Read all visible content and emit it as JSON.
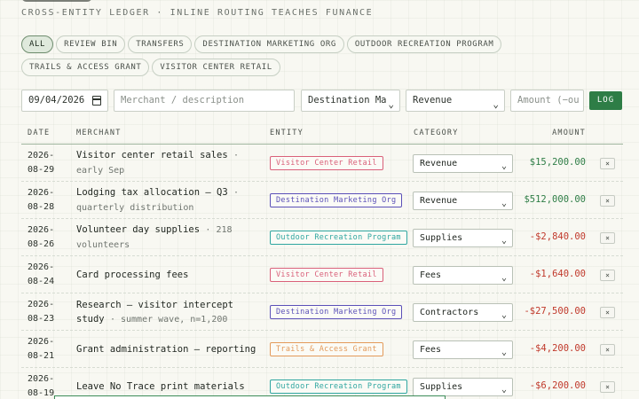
{
  "header": {
    "subtitle": "CROSS-ENTITY LEDGER · INLINE ROUTING TEACHES FUNANCE"
  },
  "filters": [
    {
      "label": "ALL",
      "active": true
    },
    {
      "label": "REVIEW BIN",
      "active": false
    },
    {
      "label": "TRANSFERS",
      "active": false
    },
    {
      "label": "DESTINATION MARKETING ORG",
      "active": false
    },
    {
      "label": "OUTDOOR RECREATION PROGRAM",
      "active": false
    },
    {
      "label": "TRAILS & ACCESS GRANT",
      "active": false
    },
    {
      "label": "VISITOR CENTER RETAIL",
      "active": false
    }
  ],
  "form": {
    "date_value": "09/04/2026",
    "merchant_placeholder": "Merchant / description",
    "entity_value": "Destination Ma",
    "category_value": "Revenue",
    "amount_placeholder": "Amount (−ou",
    "log_label": "LOG"
  },
  "table": {
    "headers": {
      "date": "DATE",
      "merchant": "MERCHANT",
      "entity": "ENTITY",
      "category": "CATEGORY",
      "amount": "AMOUNT"
    },
    "rows": [
      {
        "date_y": "2026-",
        "date_md": "08-29",
        "merchant": "Visitor center retail sales",
        "note": "early Sep",
        "entity": "Visitor Center Retail",
        "entity_color": "#d9607a",
        "category": "Revenue",
        "amount": "$15,200.00",
        "positive": true,
        "delete": "×"
      },
      {
        "date_y": "2026-",
        "date_md": "08-28",
        "merchant": "Lodging tax allocation — Q3",
        "note": "quarterly distribution",
        "entity": "Destination Marketing Org",
        "entity_color": "#5b50b8",
        "category": "Revenue",
        "amount": "$512,000.00",
        "positive": true,
        "delete": "×"
      },
      {
        "date_y": "2026-",
        "date_md": "08-26",
        "merchant": "Volunteer day supplies",
        "note": "218 volunteers",
        "entity": "Outdoor Recreation Program",
        "entity_color": "#2fa6a0",
        "category": "Supplies",
        "amount": "-$2,840.00",
        "positive": false,
        "delete": "×"
      },
      {
        "date_y": "2026-",
        "date_md": "08-24",
        "merchant": "Card processing fees",
        "note": "",
        "entity": "Visitor Center Retail",
        "entity_color": "#d9607a",
        "category": "Fees",
        "amount": "-$1,640.00",
        "positive": false,
        "delete": "×"
      },
      {
        "date_y": "2026-",
        "date_md": "08-23",
        "merchant": "Research — visitor intercept study",
        "note": "summer wave, n=1,200",
        "entity": "Destination Marketing Org",
        "entity_color": "#5b50b8",
        "category": "Contractors",
        "amount": "-$27,500.00",
        "positive": false,
        "delete": "×"
      },
      {
        "date_y": "2026-",
        "date_md": "08-21",
        "merchant": "Grant administration — reporting",
        "note": "",
        "entity": "Trails & Access Grant",
        "entity_color": "#e39a5a",
        "category": "Fees",
        "amount": "-$4,200.00",
        "positive": false,
        "delete": "×"
      },
      {
        "date_y": "2026-",
        "date_md": "08-19",
        "merchant": "Leave No Trace print materials",
        "note": "",
        "entity": "Outdoor Recreation Program",
        "entity_color": "#2fa6a0",
        "category": "Supplies",
        "amount": "-$6,200.00",
        "positive": false,
        "delete": "×"
      }
    ]
  }
}
